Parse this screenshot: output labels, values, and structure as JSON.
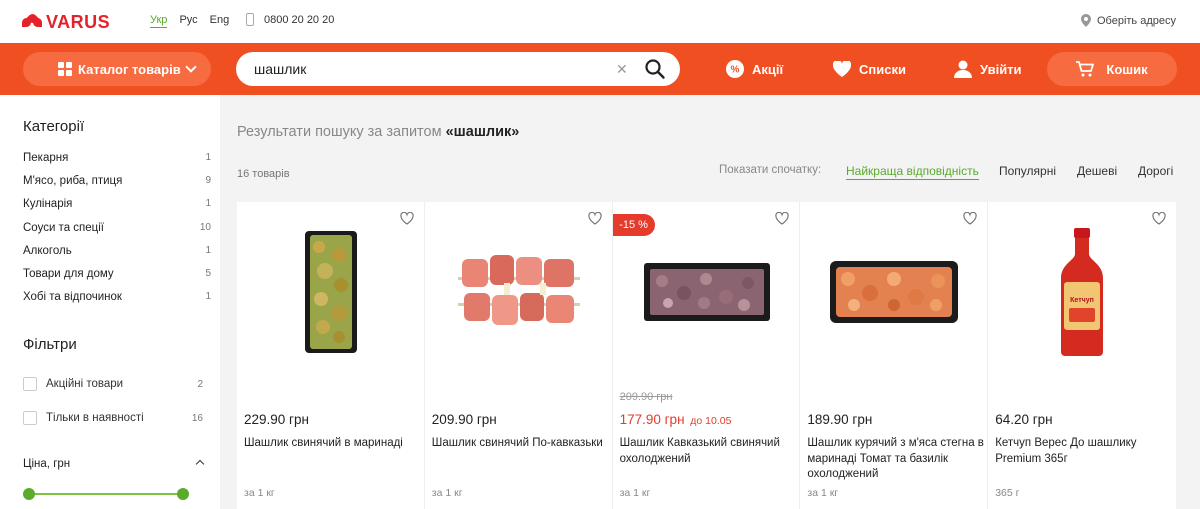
{
  "topbar": {
    "logo": "VARUS",
    "languages": [
      "Укр",
      "Рус",
      "Eng"
    ],
    "phone": "0800 20 20 20",
    "address": "Оберіть адресу"
  },
  "header": {
    "catalog": "Каталог товарів",
    "search_value": "шашлик",
    "promo": "Акції",
    "lists": "Списки",
    "login": "Увійти",
    "cart": "Кошик"
  },
  "sidebar": {
    "categories_title": "Категорії",
    "categories": [
      {
        "name": "Пекарня",
        "count": "1"
      },
      {
        "name": "М'ясо, риба, птиця",
        "count": "9"
      },
      {
        "name": "Кулінарія",
        "count": "1"
      },
      {
        "name": "Соуси та спеції",
        "count": "10"
      },
      {
        "name": "Алкоголь",
        "count": "1"
      },
      {
        "name": "Товари для дому",
        "count": "5"
      },
      {
        "name": "Хобі та відпочинок",
        "count": "1"
      }
    ],
    "filters_title": "Фільтри",
    "filters": [
      {
        "name": "Акційні товари",
        "count": "2"
      },
      {
        "name": "Тільки в наявності",
        "count": "16"
      }
    ],
    "price_label": "Ціна, грн"
  },
  "main": {
    "results_prefix": "Результати пошуку за запитом",
    "results_query": "«шашлик»",
    "goods_count": "16 товарів",
    "sort_label": "Показати спочатку:",
    "sort_options": [
      "Найкраща відповідність",
      "Популярні",
      "Дешеві",
      "Дорогі"
    ]
  },
  "products": [
    {
      "price": "229.90 грн",
      "name": "Шашлик свинячий в маринаді",
      "unit": "за 1 кг"
    },
    {
      "price": "209.90 грн",
      "name": "Шашлик свинячий По-кавказьки",
      "unit": "за 1 кг"
    },
    {
      "badge": "-15 %",
      "old_price": "209.90 грн",
      "price": "177.90 грн",
      "until": "до 10.05",
      "name": "Шашлик Кавказький свинячий охолоджений",
      "unit": "за 1 кг"
    },
    {
      "price": "189.90 грн",
      "name": "Шашлик курячий з м'яса стегна в маринаді Томат та базилік охолоджений",
      "unit": "за 1 кг"
    },
    {
      "price": "64.20 грн",
      "name": "Кетчуп Верес До шашлику Premium 365г",
      "unit": "365 г",
      "label_text": "Кетчуп"
    }
  ],
  "colors": {
    "brand": "#f04f22",
    "accent_green": "#5aaa2c",
    "sale_red": "#e53b2d"
  }
}
